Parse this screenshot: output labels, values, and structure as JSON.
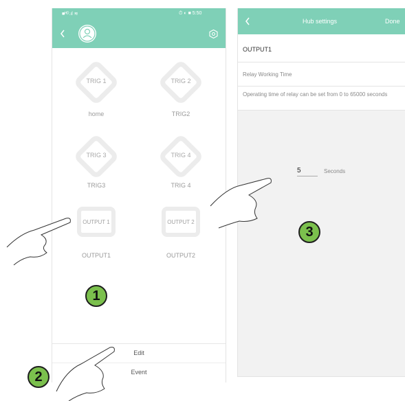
{
  "left_screen": {
    "status_left": "■ᴴᴰ.ıl ≋",
    "status_right": "⏱ ◐ ■ 5:50",
    "triggers": [
      {
        "label": "TRIG 1",
        "caption": "home"
      },
      {
        "label": "TRIG 2",
        "caption": "TRIG2"
      },
      {
        "label": "TRIG 3",
        "caption": "TRIG3"
      },
      {
        "label": "TRIG 4",
        "caption": "TRIG 4"
      }
    ],
    "outputs": [
      {
        "label": "OUTPUT 1",
        "caption": "OUTPUT1"
      },
      {
        "label": "OUTPUT 2",
        "caption": "OUTPUT2"
      }
    ],
    "bottom_buttons": {
      "edit": "Edit",
      "event": "Event"
    }
  },
  "right_screen": {
    "title": "Hub settings",
    "done_label": "Done",
    "output_name": "OUTPUT1",
    "relay_label": "Relay Working Time",
    "hint": "Operating time of relay can be set from 0 to 65000 seconds",
    "seconds_value": "5",
    "seconds_unit": "Seconds"
  },
  "markers": [
    "1",
    "2",
    "3"
  ],
  "colors": {
    "header": "#7fd0b7",
    "marker": "#7bc04d"
  },
  "icons": [
    "back-icon",
    "avatar-icon",
    "settings-icon",
    "hand-pointer-icon"
  ]
}
